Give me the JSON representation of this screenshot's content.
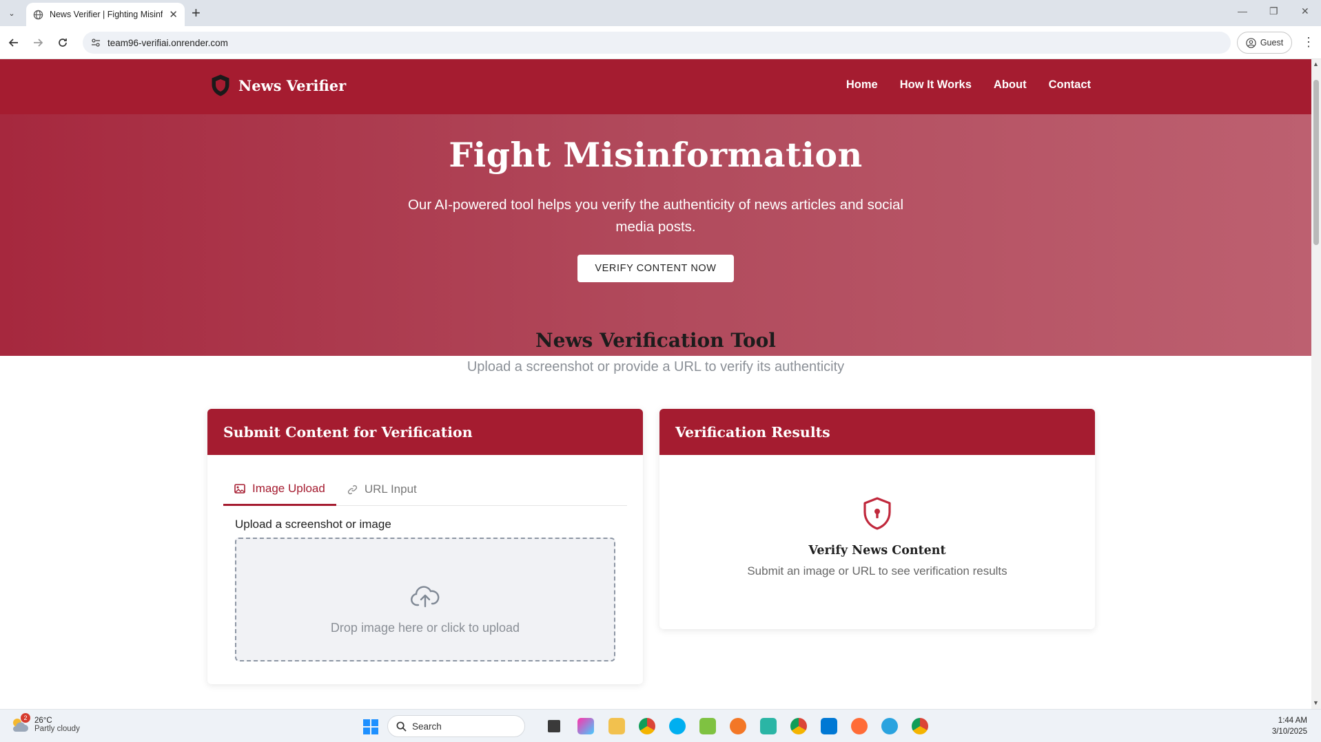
{
  "browser": {
    "tab_title": "News Verifier | Fighting Misinfo",
    "url": "team96-verifiai.onrender.com",
    "profile_label": "Guest"
  },
  "site": {
    "brand": "News Verifier",
    "nav": [
      "Home",
      "How It Works",
      "About",
      "Contact"
    ],
    "accent_color": "#a51c30"
  },
  "hero": {
    "title": "Fight Misinformation",
    "subtitle": "Our AI-powered tool helps you verify the authenticity of news articles and social media posts.",
    "cta": "VERIFY CONTENT NOW"
  },
  "tool": {
    "title": "News Verification Tool",
    "subtitle": "Upload a screenshot or provide a URL to verify its authenticity",
    "submit_card": {
      "header": "Submit Content for Verification",
      "tabs": [
        {
          "label": "Image Upload",
          "icon": "image-icon",
          "active": true
        },
        {
          "label": "URL Input",
          "icon": "link-icon",
          "active": false
        }
      ],
      "upload_label": "Upload a screenshot or image",
      "drop_text": "Drop image here or click to upload"
    },
    "results_card": {
      "header": "Verification Results",
      "icon": "shield-lock-icon",
      "title": "Verify News Content",
      "subtitle": "Submit an image or URL to see verification results"
    }
  },
  "taskbar": {
    "weather_badge": "2",
    "temperature": "26°C",
    "weather": "Partly cloudy",
    "search_label": "Search",
    "time": "1:44 AM",
    "date": "3/10/2025"
  }
}
